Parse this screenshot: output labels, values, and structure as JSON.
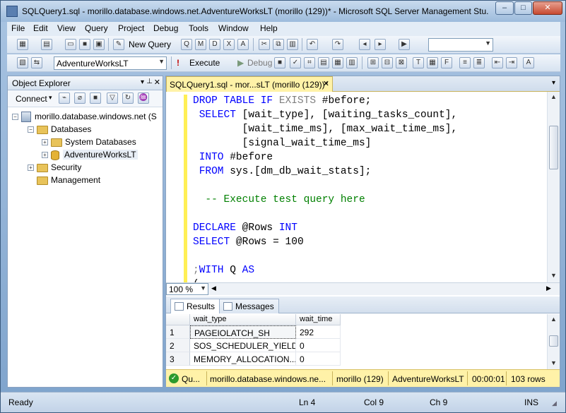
{
  "window": {
    "title": "SQLQuery1.sql - morillo.database.windows.net.AdventureWorksLT (morillo (129))* - Microsoft SQL Server Management Stu...",
    "minimize": "–",
    "maximize": "□",
    "close": "✕"
  },
  "menu": [
    "File",
    "Edit",
    "View",
    "Query",
    "Project",
    "Debug",
    "Tools",
    "Window",
    "Help"
  ],
  "toolbar1": {
    "new_query": "New Query"
  },
  "toolbar2": {
    "database": "AdventureWorksLT",
    "execute": "Execute",
    "debug": "Debug"
  },
  "object_explorer": {
    "title": "Object Explorer",
    "connect": "Connect",
    "tree": {
      "server": "morillo.database.windows.net (S",
      "databases": "Databases",
      "system_databases": "System Databases",
      "adventureworks": "AdventureWorksLT",
      "security": "Security",
      "management": "Management"
    }
  },
  "editor": {
    "tab_label": "SQLQuery1.sql - mor...sLT (morillo (129))*",
    "zoom": "100 %",
    "lines": {
      "l1_kw": "DROP TABLE IF",
      "l1_gr": " EXISTS",
      "l1_rest": " #before;",
      "l2_kw": " SELECT",
      "l2_rest": " [wait_type], [waiting_tasks_count],",
      "l3": "        [wait_time_ms], [max_wait_time_ms],",
      "l4": "        [signal_wait_time_ms]",
      "l5_kw": " INTO",
      "l5_rest": " #before",
      "l6_kw": " FROM",
      "l6_rest": " sys.[dm_db_wait_stats];",
      "l7": "  -- Execute test query here",
      "l8_kw": "DECLARE",
      "l8_var": " @Rows",
      "l8_kw2": " INT",
      "l9_kw": "SELECT",
      "l9_var": " @Rows",
      "l9_rest": " = 100",
      "l10_gr": ";",
      "l10_kw": "WITH",
      "l10_rest": " Q ",
      "l10_kw2": "AS",
      "l11": "("
    }
  },
  "results": {
    "tabs": [
      "Results",
      "Messages"
    ],
    "columns": [
      "wait_type",
      "wait_time"
    ],
    "rows": [
      {
        "num": "1",
        "wait_type": "PAGEIOLATCH_SH",
        "wait_time": "292"
      },
      {
        "num": "2",
        "wait_type": "SOS_SCHEDULER_YIELD",
        "wait_time": "0"
      },
      {
        "num": "3",
        "wait_type": "MEMORY_ALLOCATION...",
        "wait_time": "0"
      }
    ]
  },
  "query_status": {
    "state": "Qu...",
    "server": "morillo.database.windows.ne...",
    "user": "morillo (129)",
    "database": "AdventureWorksLT",
    "elapsed": "00:00:01",
    "rows": "103 rows"
  },
  "statusbar": {
    "ready": "Ready",
    "ln": "Ln 4",
    "col": "Col 9",
    "ch": "Ch 9",
    "ins": "INS"
  },
  "colors": {
    "keyword": "#0000ff",
    "comment": "#008000",
    "tab_highlight": "#fff2a8"
  }
}
